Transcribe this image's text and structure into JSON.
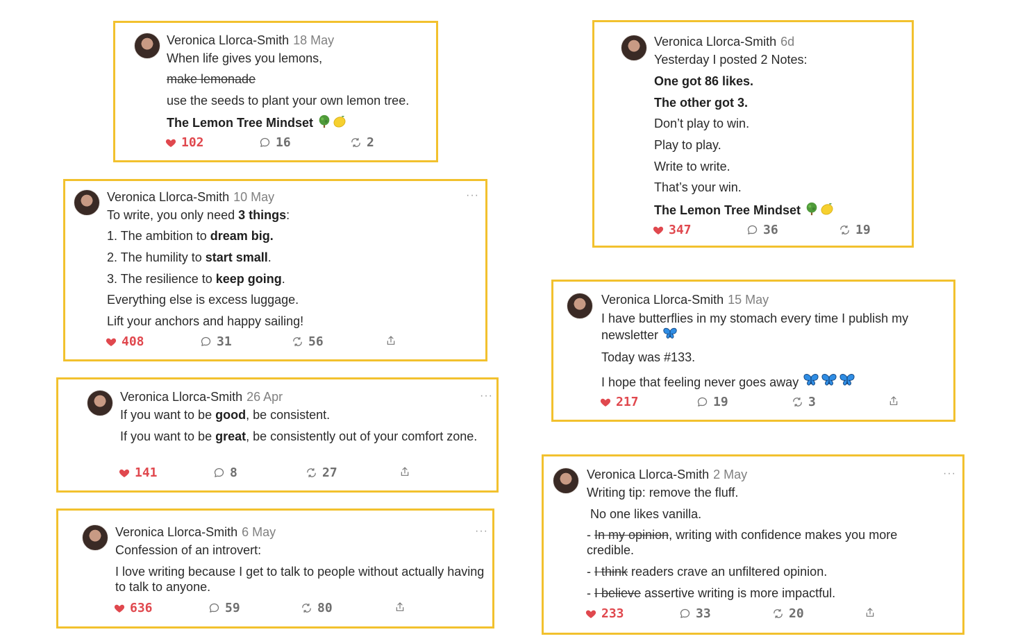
{
  "colors": {
    "border": "#f2c12e",
    "like": "#e0484e",
    "muted": "#808080"
  },
  "author": "Veronica Llorca-Smith",
  "more_label": "···",
  "notes": {
    "n1": {
      "date": "18 May",
      "l1": "When life gives you lemons,",
      "l2": "make lemonade",
      "l3": "use the seeds to plant your own lemon tree.",
      "l4": "The Lemon Tree Mindset",
      "likes": "102",
      "comments": "16",
      "restacks": "2"
    },
    "n2": {
      "date": "10 May",
      "l1a": "To write, you only need ",
      "l1b": "3 things",
      "l1c": ":",
      "l2a": "1. The ambition to ",
      "l2b": "dream big.",
      "l3a": "2. The humility to ",
      "l3b": "start small",
      "l3c": ".",
      "l4a": "3. The resilience to ",
      "l4b": "keep going",
      "l4c": ".",
      "l5": "Everything else is excess luggage.",
      "l6": "Lift your anchors and happy sailing!",
      "likes": "408",
      "comments": "31",
      "restacks": "56"
    },
    "n3": {
      "date": "26 Apr",
      "l1a": "If you want to be ",
      "l1b": "good",
      "l1c": ", be consistent.",
      "l2a": "If you want to be ",
      "l2b": "great",
      "l2c": ", be consistently out of your comfort zone.",
      "likes": "141",
      "comments": "8",
      "restacks": "27"
    },
    "n4": {
      "date": "6 May",
      "l1": "Confession of an introvert:",
      "l2": "I love writing because I get to talk to people without actually having to talk to anyone.",
      "likes": "636",
      "comments": "59",
      "restacks": "80"
    },
    "n5": {
      "date": "6d",
      "l1": "Yesterday I posted 2 Notes:",
      "l2": "One got 86 likes.",
      "l3": "The other got 3.",
      "l4": "Don’t play to win.",
      "l5": "Play to play.",
      "l6": "Write to write.",
      "l7": "That’s your win.",
      "l8": "The Lemon Tree Mindset",
      "likes": "347",
      "comments": "36",
      "restacks": "19"
    },
    "n6": {
      "date": "15 May",
      "l1": "I have butterflies in my stomach every time I publish my newsletter",
      "l2": "Today was #133.",
      "l3": "I hope that feeling never goes away",
      "likes": "217",
      "comments": "19",
      "restacks": "3"
    },
    "n7": {
      "date": "2 May",
      "l1": "Writing tip: remove the fluff.",
      "l2": "No one likes vanilla.",
      "l3a": "- ",
      "l3s": "In my opinion",
      "l3b": ", writing with confidence makes you more credible.",
      "l4a": "- ",
      "l4s": "I think",
      "l4b": " readers crave an unfiltered opinion.",
      "l5a": "- ",
      "l5s": "I believe",
      "l5b": " assertive writing is more impactful.",
      "likes": "233",
      "comments": "33",
      "restacks": "20"
    }
  }
}
